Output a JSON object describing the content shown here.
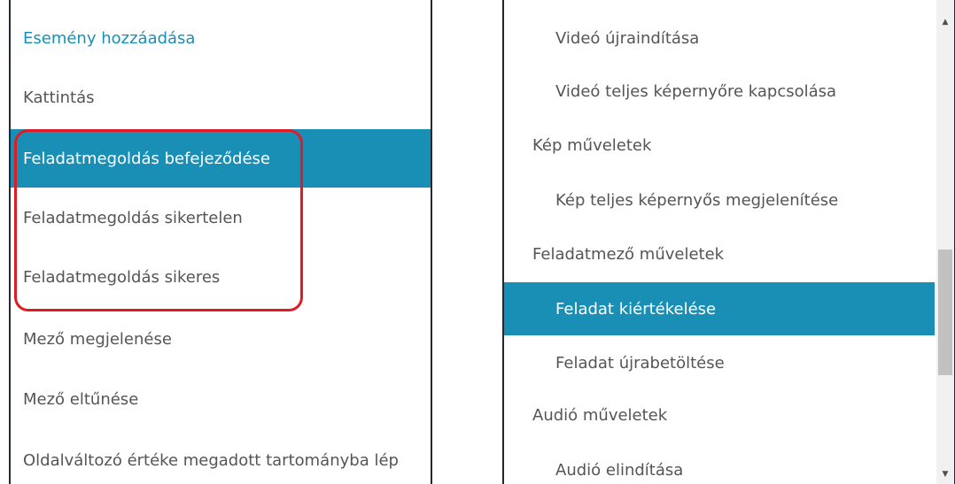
{
  "left_list": {
    "header": "Esemény hozzáadása",
    "items": [
      "Kattintás",
      "Feladatmegoldás befejeződése",
      "Feladatmegoldás sikertelen",
      "Feladatmegoldás sikeres",
      "Mező megjelenése",
      "Mező eltűnése",
      "Oldalváltozó értéke megadott tartományba lép"
    ],
    "selected_item": "Feladatmegoldás befejeződése"
  },
  "right_list": {
    "items": [
      "Videó újraindítása",
      "Videó teljes képernyőre kapcsolása",
      "Kép műveletek",
      "Kép teljes képernyős megjelenítése",
      "Feladatmező műveletek",
      "Feladat kiértékelése",
      "Feladat újrabetöltése",
      "Audió műveletek",
      "Audió elindítása"
    ],
    "selected_item": "Feladat kiértékelése"
  },
  "scrollbar": {
    "up_icon": "▲",
    "down_icon": "▼",
    "scroll_fraction": 0.55
  },
  "colors": {
    "accent": "#1a8fb6",
    "highlight": "#e01b24",
    "text": "#555555"
  }
}
